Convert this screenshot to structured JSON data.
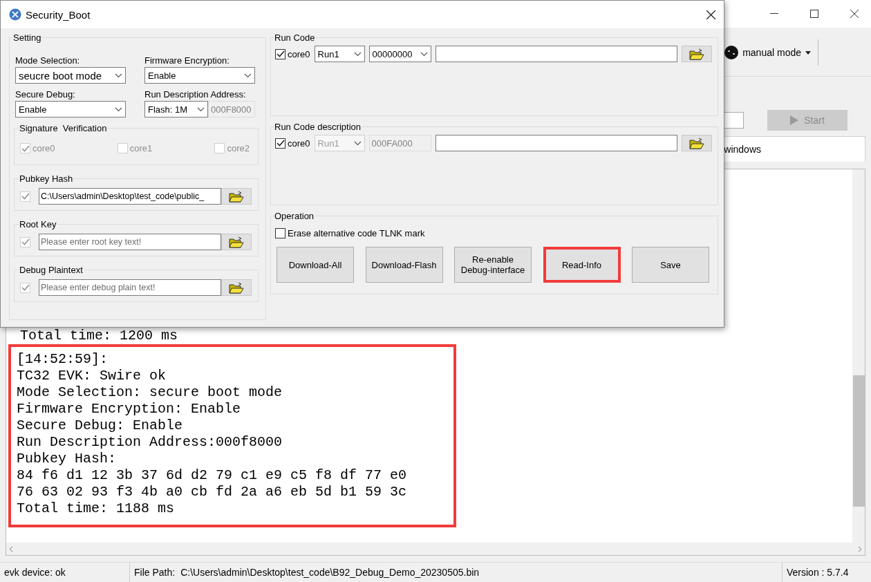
{
  "main_window": {
    "mode_button": {
      "label": "manual mode"
    },
    "start_button": {
      "label": "Start",
      "disabled": true
    },
    "tab": {
      "label": "windows"
    },
    "log": {
      "hidden_line": "Total time: 1200 ms",
      "highlighted_lines": [
        "[14:52:59]:",
        "TC32 EVK: Swire ok",
        "Mode Selection: secure boot mode",
        "Firmware Encryption: Enable",
        "Secure Debug: Enable",
        "Run Description Address:000f8000",
        "Pubkey Hash:",
        "84 f6 d1 12 3b 37 6d d2 79 c1 e9 c5 f8 df 77 e0",
        "76 63 02 93 f3 4b a0 cb fd 2a a6 eb 5d b1 59 3c",
        "Total time: 1188 ms"
      ]
    }
  },
  "status_bar": {
    "device": "evk device: ok",
    "file_path_label": "File Path:",
    "file_path": "C:\\Users\\admin\\Desktop\\test_code\\B92_Debug_Demo_20230505.bin",
    "version": "Version : 5.7.4"
  },
  "dialog": {
    "title": "Security_Boot",
    "setting": {
      "title": "Setting",
      "mode_selection": {
        "label": "Mode Selection:",
        "value": "seucre boot mode"
      },
      "firmware_encryption": {
        "label": "Firmware Encryption:",
        "value": "Enable"
      },
      "secure_debug": {
        "label": "Secure Debug:",
        "value": "Enable"
      },
      "run_description_address": {
        "label": "Run Description Address:",
        "flash": "Flash: 1M",
        "address": "000F8000"
      },
      "signature_verification": {
        "title": "Signature  Verification",
        "cores": [
          {
            "label": "core0",
            "checked": true,
            "disabled": true
          },
          {
            "label": "core1",
            "checked": false,
            "disabled": true
          },
          {
            "label": "core2",
            "checked": false,
            "disabled": true
          }
        ]
      },
      "keys": [
        {
          "title": "Pubkey Hash",
          "checked": true,
          "disabled": true,
          "value": "C:\\Users\\admin\\Desktop\\test_code\\public_"
        },
        {
          "title": "Root Key",
          "checked": true,
          "disabled": true,
          "placeholder": "Please enter root key text!"
        },
        {
          "title": "Debug Plaintext",
          "checked": true,
          "disabled": true,
          "placeholder": "Please enter debug plain text!"
        }
      ]
    },
    "run_groups": [
      {
        "title": "Run Code",
        "core": {
          "label": "core0",
          "checked": true
        },
        "run": {
          "value": "Run1",
          "disabled": false
        },
        "address": {
          "value": "00000000",
          "kind": "dropdown"
        }
      },
      {
        "title": "Run Code description",
        "core": {
          "label": "core0",
          "checked": true
        },
        "run": {
          "value": "Run1",
          "disabled": true
        },
        "address": {
          "value": "000FA000",
          "kind": "readonly"
        }
      }
    ],
    "operation": {
      "title": "Operation",
      "erase": {
        "label": "Erase alternative code TLNK mark",
        "checked": false
      },
      "buttons": [
        {
          "label": "Download-All",
          "highlighted": false
        },
        {
          "label": "Download-Flash",
          "highlighted": false
        },
        {
          "label": "Re-enable Debug-interface",
          "highlighted": false
        },
        {
          "label": "Read-Info",
          "highlighted": true
        },
        {
          "label": "Save",
          "highlighted": false
        }
      ]
    }
  }
}
